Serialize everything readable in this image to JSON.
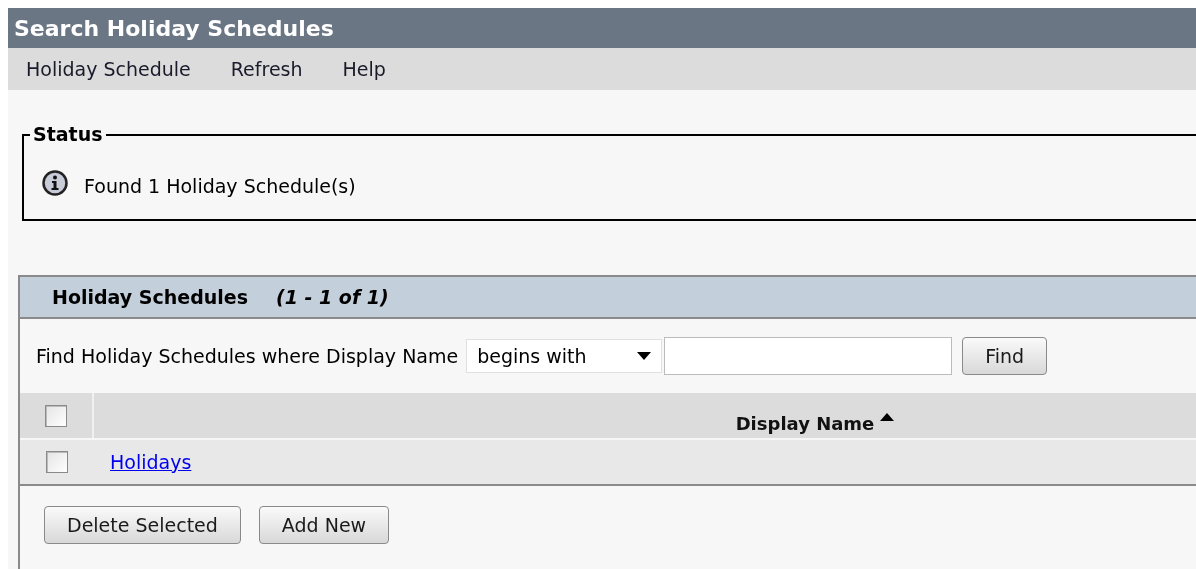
{
  "window": {
    "title": "Search Holiday Schedules"
  },
  "menu": [
    "Holiday Schedule",
    "Refresh",
    "Help"
  ],
  "status": {
    "legend": "Status",
    "message": "Found 1 Holiday Schedule(s)"
  },
  "panel": {
    "title": "Holiday Schedules",
    "range": "(1 - 1 of 1)",
    "find": {
      "label": "Find Holiday Schedules where Display Name",
      "operator": "begins with",
      "button": "Find"
    },
    "table": {
      "select_all_checked": false,
      "columns": [
        "Display Name"
      ],
      "sort_ascending": true,
      "rows": [
        {
          "name": "Holidays",
          "checked": false
        }
      ]
    },
    "buttons": [
      "Delete Selected",
      "Add New"
    ]
  }
}
